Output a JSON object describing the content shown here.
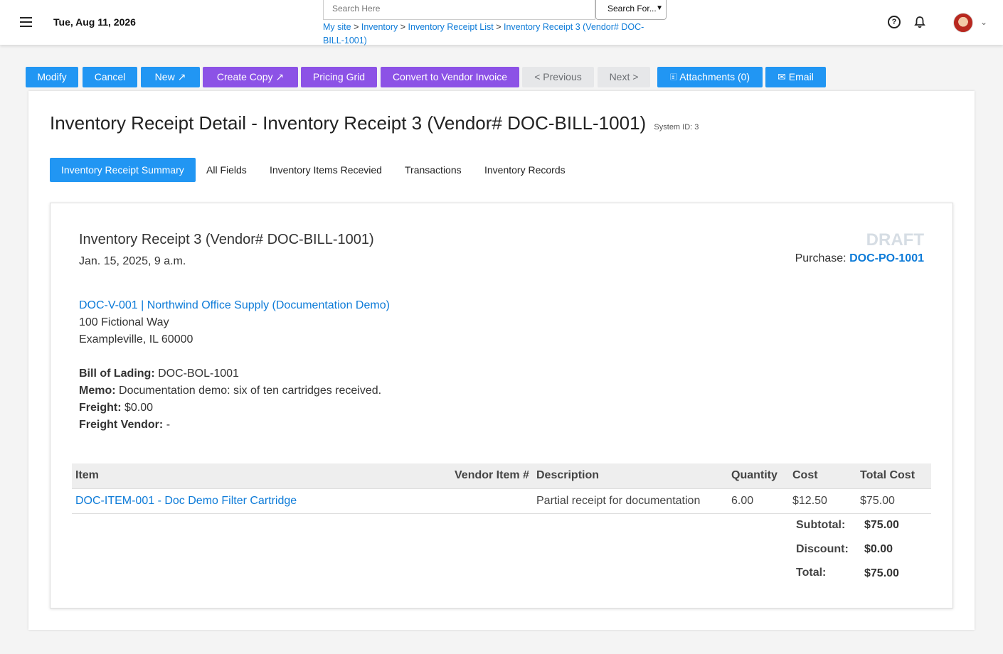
{
  "header": {
    "date": "Tue, Aug 11, 2026",
    "search_placeholder": "Search Here",
    "search_for": "Search For...",
    "breadcrumb": [
      "My site",
      "Inventory",
      "Inventory Receipt List",
      "Inventory Receipt 3 (Vendor# DOC-BILL-1001)"
    ]
  },
  "actions": {
    "modify": "Modify",
    "cancel": "Cancel",
    "new": "New ↗",
    "create_copy": "Create Copy ↗",
    "pricing_grid": "Pricing Grid",
    "convert": "Convert to Vendor Invoice",
    "previous": "< Previous",
    "next": "Next >",
    "attachments": "🗉 Attachments (0)",
    "email": "✉ Email"
  },
  "page": {
    "title": "Inventory Receipt Detail - Inventory Receipt 3 (Vendor# DOC-BILL-1001)",
    "system_id": "System ID: 3"
  },
  "tabs": [
    "Inventory Receipt Summary",
    "All Fields",
    "Inventory Items Recevied",
    "Transactions",
    "Inventory Records"
  ],
  "receipt": {
    "title": "Inventory Receipt 3 (Vendor# DOC-BILL-1001)",
    "date": "Jan. 15, 2025, 9 a.m.",
    "status": "DRAFT",
    "purchase_label": "Purchase:",
    "purchase_link": "DOC-PO-1001",
    "vendor_link": "DOC-V-001 | Northwind Office Supply (Documentation Demo)",
    "address1": "100 Fictional Way",
    "address2": "Exampleville, IL 60000",
    "bill_of_lading_label": "Bill of Lading:",
    "bill_of_lading": "DOC-BOL-1001",
    "memo_label": "Memo:",
    "memo": "Documentation demo: six of ten cartridges received.",
    "freight_label": "Freight:",
    "freight": "$0.00",
    "freight_vendor_label": "Freight Vendor:",
    "freight_vendor": "-"
  },
  "items_table": {
    "columns": [
      "Item",
      "Vendor Item #",
      "Description",
      "Quantity",
      "Cost",
      "Total Cost"
    ],
    "rows": [
      {
        "item": "DOC-ITEM-001 - Doc Demo Filter Cartridge",
        "vendor_item": "",
        "description": "Partial receipt for documentation",
        "quantity": "6.00",
        "cost": "$12.50",
        "total": "$75.00"
      }
    ]
  },
  "totals": {
    "subtotal_label": "Subtotal:",
    "subtotal": "$75.00",
    "discount_label": "Discount:",
    "discount": "$0.00",
    "total_label": "Total:",
    "total": "$75.00"
  }
}
